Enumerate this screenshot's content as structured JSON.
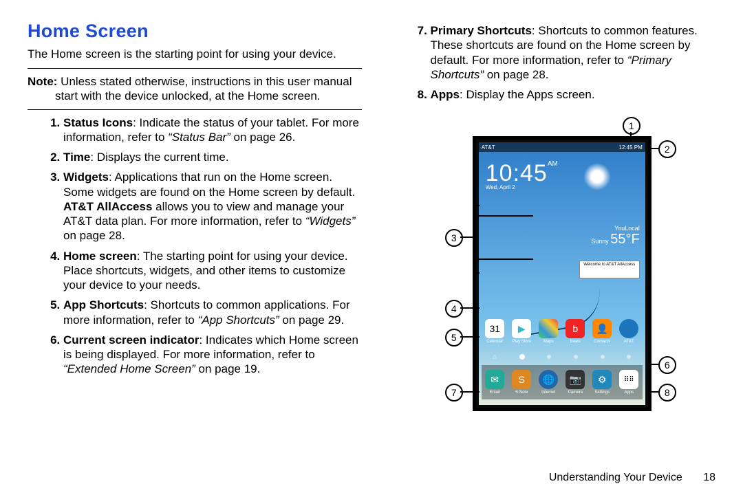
{
  "heading": "Home Screen",
  "intro": "The Home screen is the starting point for using your device.",
  "note_label": "Note:",
  "note_text": " Unless stated otherwise, instructions in this user manual start with the device unlocked, at the Home screen.",
  "items": {
    "i1_b": "Status Icons",
    "i1_t1": ": Indicate the status of your tablet. For more information, refer to ",
    "i1_i": "“Status Bar”",
    "i1_t2": " on page 26.",
    "i2_b": "Time",
    "i2_t": ": Displays the current time.",
    "i3_b": "Widgets",
    "i3_t1": ": Applications that run on the Home screen. Some widgets are found on the Home screen by default. ",
    "i3_b2": "AT&T AllAccess",
    "i3_t2": " allows you to view and manage your AT&T data plan. For more information, refer to ",
    "i3_i": "“Widgets”",
    "i3_t3": " on page 28.",
    "i4_b": "Home screen",
    "i4_t": ": The starting point for using your device. Place shortcuts, widgets, and other items to customize your device to your needs.",
    "i5_b": "App Shortcuts",
    "i5_t1": ": Shortcuts to common applications. For more information, refer to ",
    "i5_i": "“App Shortcuts”",
    "i5_t2": " on page 29.",
    "i6_b": "Current screen indicator",
    "i6_t1": ": Indicates which Home screen is being displayed. For more information, refer to ",
    "i6_i": "“Extended Home Screen”",
    "i6_t2": " on page 19.",
    "i7_b": "Primary Shortcuts",
    "i7_t1": ": Shortcuts to common features. These shortcuts are found on the Home screen by default. For more information, refer to ",
    "i7_i": "“Primary Shortcuts”",
    "i7_t2": " on page 28.",
    "i8_b": "Apps",
    "i8_t": ": Display the Apps screen."
  },
  "figure": {
    "status_left": "AT&T",
    "status_right": "12:45 PM",
    "clock_time": "10:45",
    "clock_ampm": "AM",
    "clock_date": "Wed, April 2",
    "weather_loc": "YouLocal",
    "weather_cond": "Sunny",
    "weather_temp": "55°F",
    "allaccess": "Welcome to AT&T AllAccess",
    "apps_row": [
      "Calendar",
      "Play Store",
      "Maps",
      "Beats",
      "Contacts",
      "AT&T"
    ],
    "dock_row": [
      "Email",
      "S Note",
      "Internet",
      "Camera",
      "Settings",
      "Apps"
    ],
    "callouts": {
      "c1": "1",
      "c2": "2",
      "c3": "3",
      "c4": "4",
      "c5": "5",
      "c6": "6",
      "c7": "7",
      "c8": "8"
    }
  },
  "footer_section": "Understanding Your Device",
  "footer_page": "18"
}
